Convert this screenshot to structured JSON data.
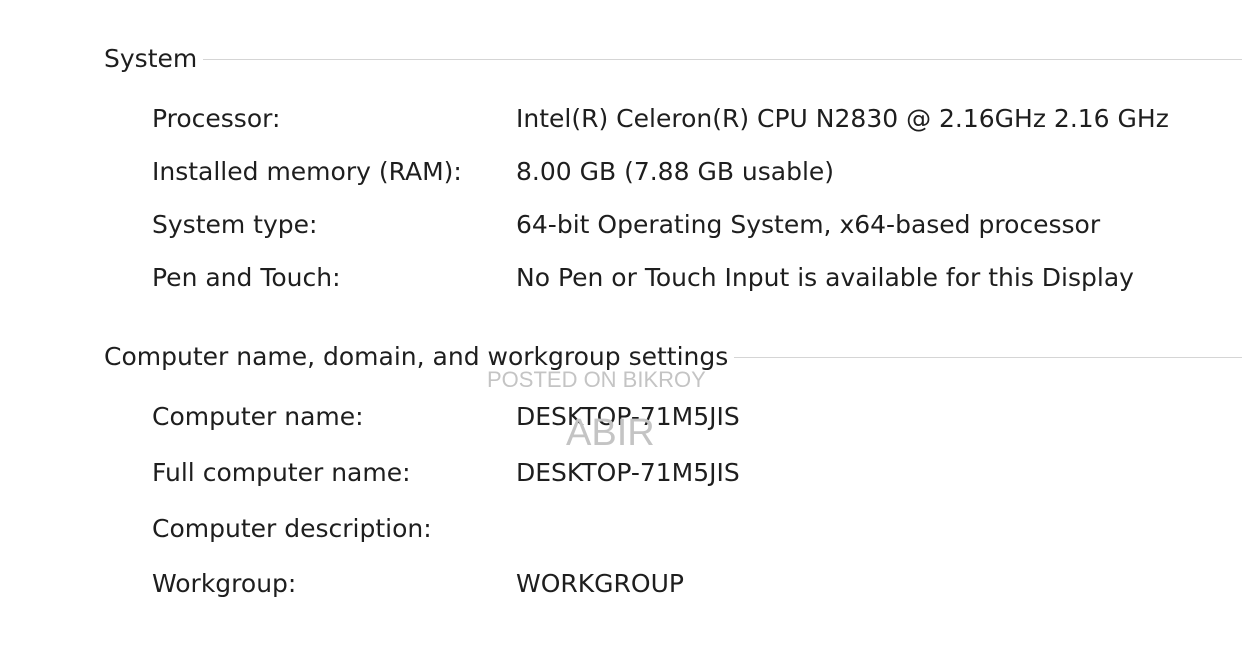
{
  "sections": {
    "system": {
      "title": "System",
      "rows": [
        {
          "label": "Processor:",
          "value": "Intel(R) Celeron(R) CPU  N2830  @ 2.16GHz   2.16 GHz"
        },
        {
          "label": "Installed memory (RAM):",
          "value": "8.00 GB (7.88 GB usable)"
        },
        {
          "label": "System type:",
          "value": "64-bit Operating System, x64-based processor"
        },
        {
          "label": "Pen and Touch:",
          "value": "No Pen or Touch Input is available for this Display"
        }
      ]
    },
    "computer_name": {
      "title": "Computer name, domain, and workgroup settings",
      "rows": [
        {
          "label": "Computer name:",
          "value": "DESKTOP-71M5JIS"
        },
        {
          "label": "Full computer name:",
          "value": "DESKTOP-71M5JIS"
        },
        {
          "label": "Computer description:",
          "value": ""
        },
        {
          "label": "Workgroup:",
          "value": "WORKGROUP"
        }
      ]
    }
  },
  "watermark": {
    "line1": "POSTED ON BIKROY",
    "line2": "ABIR"
  }
}
